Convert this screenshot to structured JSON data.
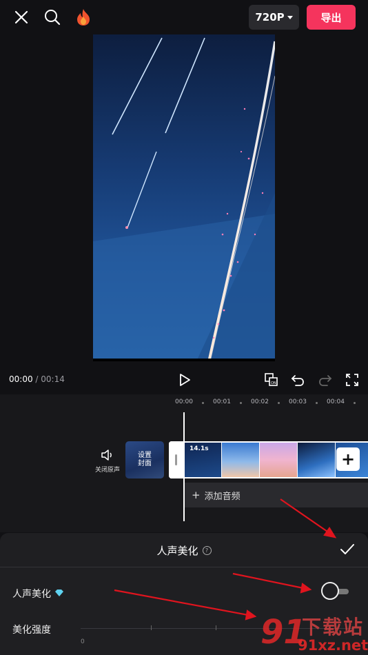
{
  "header": {
    "close_icon": "close-icon",
    "search_icon": "search-icon",
    "flame_icon": "flame-icon",
    "resolution": "720P",
    "export_label": "导出"
  },
  "playback": {
    "current_time": "00:00",
    "separator": " / ",
    "total_time": "00:14"
  },
  "timeline": {
    "ruler": [
      "00:00",
      "00:01",
      "00:02",
      "00:03",
      "00:04"
    ],
    "mute_label": "关闭原声",
    "cover_label_line1": "设置",
    "cover_label_line2": "封面",
    "clip_duration": "14.1s",
    "add_clip": "+",
    "add_audio_label": "添加音频"
  },
  "panel": {
    "title": "人声美化",
    "help": "?",
    "row1_label": "人声美化",
    "row2_label": "美化强度",
    "slider_min": "0",
    "toggle_on": false
  },
  "watermark": {
    "logo": "91",
    "text1": "下载站",
    "text2": "91xz.net"
  },
  "colors": {
    "accent": "#f5345d",
    "background": "#111114",
    "panel": "#1f1f22"
  }
}
